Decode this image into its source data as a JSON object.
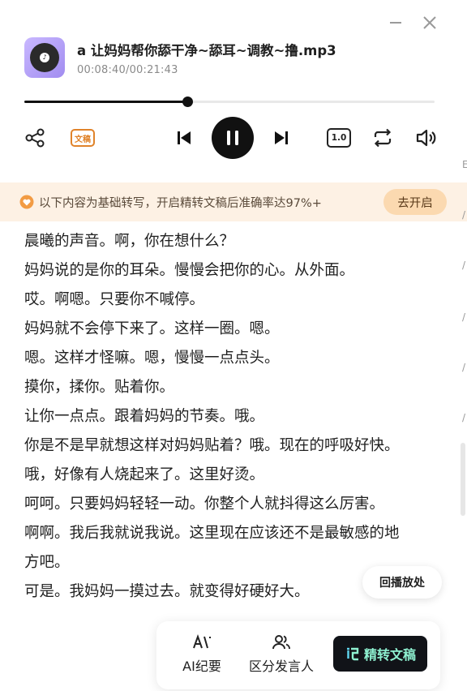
{
  "window": {
    "minimize_icon": "minimize-icon",
    "close_icon": "close-icon"
  },
  "track": {
    "title": "a 让妈妈帮你舔干净~舔耳~调教~撸.mp3",
    "time": "00:08:40/00:21:43",
    "progress": 0.398,
    "cover_icon": "music-disc-icon"
  },
  "controls": {
    "share_icon": "share-icon",
    "doc_label": "文稿",
    "prev_icon": "skip-previous-icon",
    "play_state_icon": "pause-icon",
    "next_icon": "skip-next-icon",
    "speed_label": "1.0",
    "loop_icon": "repeat-icon",
    "volume_icon": "volume-icon"
  },
  "banner": {
    "icon": "heart-badge-icon",
    "text": "以下内容为基础转写，开启精转文稿后准确率达97%+",
    "button": "去开启",
    "bg": "#fdf1e4"
  },
  "transcript": [
    "晨曦的声音。啊，你在想什么？",
    "妈妈说的是你的耳朵。慢慢会把你的心。从外面。",
    "哎。啊嗯。只要你不喊停。",
    "妈妈就不会停下来了。这样一圈。嗯。",
    "嗯。这样才怪嘛。嗯，慢慢一点点头。",
    "摸你，揉你。贴着你。",
    "让你一点点。跟着妈妈的节奏。哦。",
    "你是不是早就想这样对妈妈贴着？哦。现在的呼吸好快。",
    "哦，好像有人烧起来了。这里好烫。",
    "呵呵。只要妈妈轻轻一动。你整个人就抖得这么厉害。",
    "啊啊。我后我就说我说。这里现在应该还不是最敏感的地",
    "方吧。",
    "可是。我妈妈一摸过去。就变得好硬好大。"
  ],
  "locate_button": "回播放处",
  "toolbar": {
    "ai_summary": {
      "label": "AI纪要",
      "icon": "ai-icon"
    },
    "speakers": {
      "label": "区分发言人",
      "icon": "people-icon"
    },
    "pro": {
      "label": "精转文稿",
      "icon": "pro-doc-icon",
      "accent": "#8ef0d0"
    }
  },
  "edge_glyphs": [
    "E",
    "/",
    "/",
    "/",
    "/",
    "/"
  ]
}
